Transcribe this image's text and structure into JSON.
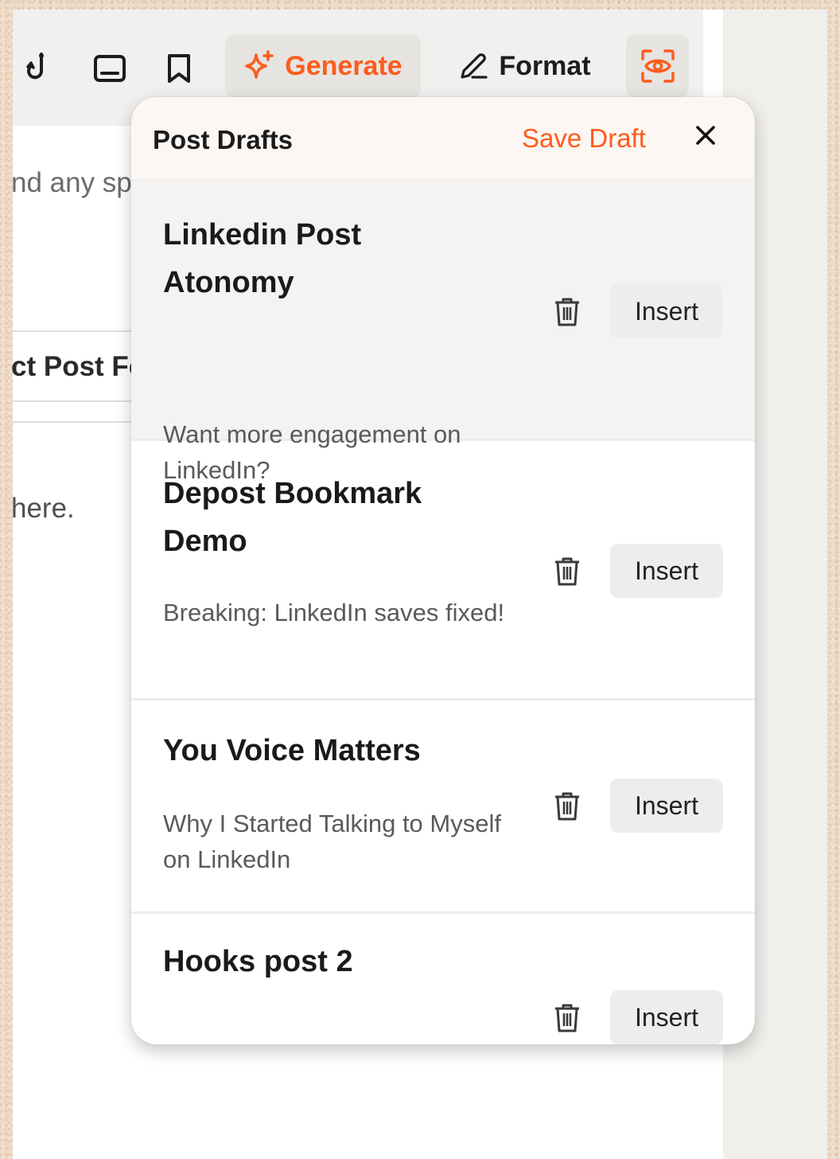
{
  "toolbar": {
    "icons": [
      "hook-icon",
      "inbox-icon",
      "bookmark-icon"
    ],
    "generate_label": "Generate",
    "format_label": "Format",
    "preview_icon": "eye-scan-icon",
    "accent_color": "#fe5b1c"
  },
  "background_editor": {
    "hint_fragment": "nd any sp",
    "select_fragment": "ct Post Fo",
    "placeholder_fragment": "here."
  },
  "drafts_panel": {
    "title": "Post Drafts",
    "save_label": "Save Draft",
    "close_icon": "close-icon",
    "insert_label": "Insert",
    "drafts": [
      {
        "title": "Linkedin Post Atonomy",
        "preview": "Want more engagement on LinkedIn?",
        "selected": true
      },
      {
        "title": "Depost Bookmark Demo",
        "preview": "Breaking: LinkedIn saves fixed!",
        "selected": false
      },
      {
        "title": "You Voice Matters",
        "preview": "Why I Started Talking to Myself on LinkedIn",
        "selected": false
      },
      {
        "title": "Hooks post 2",
        "preview": "",
        "selected": false
      }
    ]
  }
}
